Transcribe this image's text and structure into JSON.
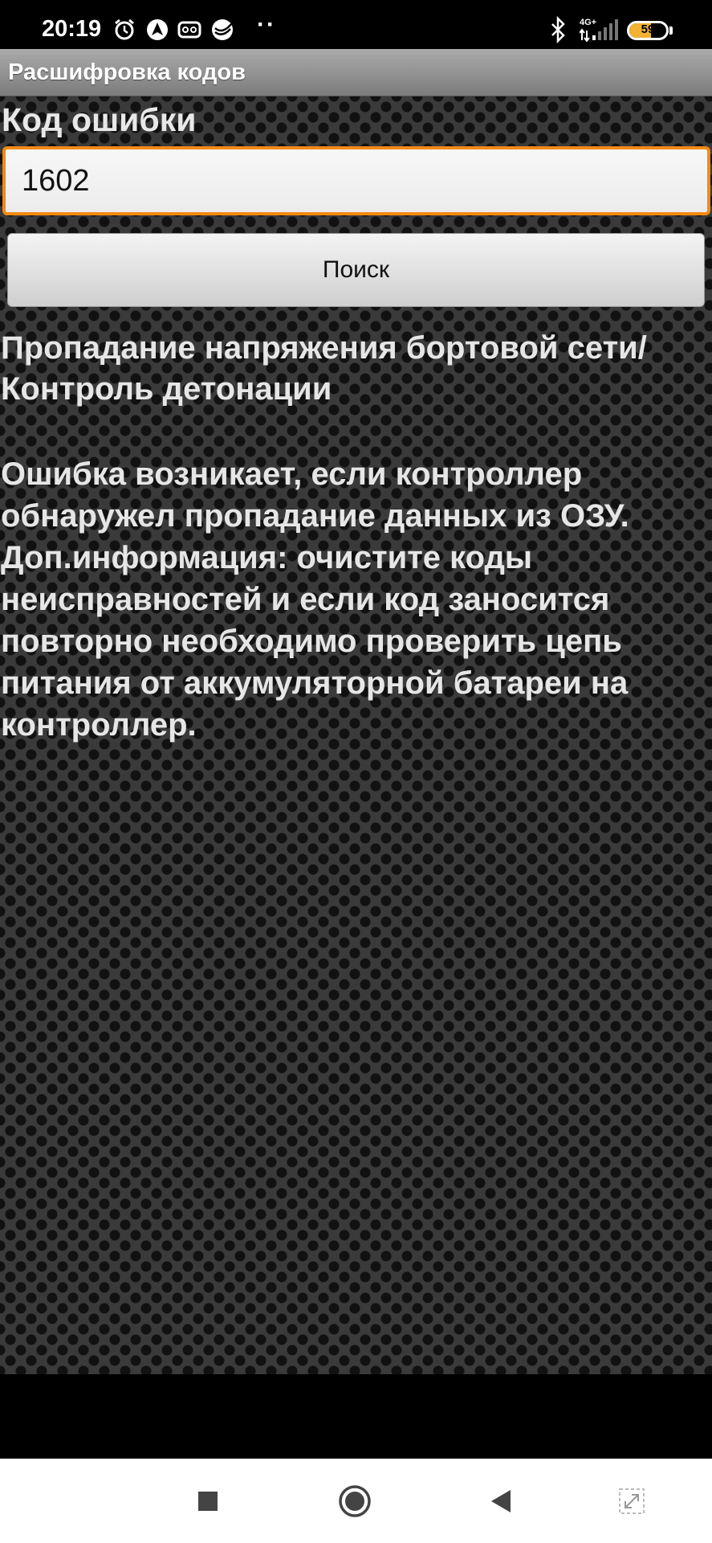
{
  "status_bar": {
    "time": "20:19",
    "dots": "··",
    "battery": 59,
    "battery_color": "#f2b233",
    "network": "4G+",
    "icons": [
      "alarm-icon",
      "navigation-icon",
      "voicemail-icon",
      "sberbank-icon",
      "bluetooth-icon",
      "signal-icon",
      "battery-icon"
    ]
  },
  "title_bar": {
    "title": "Расшифровка кодов"
  },
  "form": {
    "label": "Код ошибки",
    "input_value": "1602",
    "accent_color": "#f28a14",
    "search_label": "Поиск"
  },
  "result": {
    "title": "Пропадание напряжения бортовой сети/ Контроль детонации",
    "description": "Ошибка возникает, если контроллер обнаружел пропадание данных из ОЗУ. Доп.информация: очистите коды неисправностей и если код заносится повторно необходимо проверить цепь питания от аккумуляторной батареи на контроллер."
  },
  "nav_bar": {
    "buttons": [
      "recents-icon",
      "home-icon",
      "back-icon",
      "rotate-icon"
    ]
  }
}
